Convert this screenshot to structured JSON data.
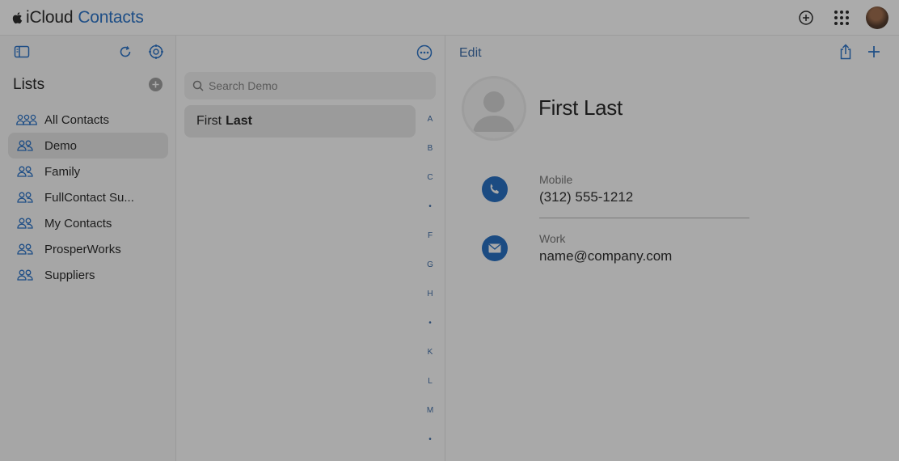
{
  "header": {
    "brand": "iCloud",
    "app_name": "Contacts",
    "icons": [
      "apple-logo-icon",
      "add-circle-icon",
      "app-grid-icon",
      "account-avatar"
    ]
  },
  "sidebar": {
    "icons": [
      "sidebar-toggle-icon",
      "refresh-icon",
      "settings-icon"
    ],
    "title": "Lists",
    "items": [
      {
        "label": "All Contacts",
        "icon": "all-contacts-group-icon",
        "selected": false
      },
      {
        "label": "Demo",
        "icon": "group-icon",
        "selected": true
      },
      {
        "label": "Family",
        "icon": "group-icon",
        "selected": false
      },
      {
        "label": "FullContact Su...",
        "icon": "group-icon",
        "selected": false
      },
      {
        "label": "My Contacts",
        "icon": "group-icon",
        "selected": false
      },
      {
        "label": "ProsperWorks",
        "icon": "group-icon",
        "selected": false
      },
      {
        "label": "Suppliers",
        "icon": "group-icon",
        "selected": false
      }
    ]
  },
  "contact_list": {
    "search_placeholder": "Search Demo",
    "contacts": [
      {
        "first": "First",
        "last": "Last"
      }
    ],
    "index_letters": [
      "A",
      "B",
      "C",
      "•",
      "F",
      "G",
      "H",
      "•",
      "K",
      "L",
      "M",
      "•"
    ]
  },
  "detail": {
    "edit_label": "Edit",
    "name": "First Last",
    "fields": [
      {
        "label": "Mobile",
        "value": "(312) 555-1212",
        "icon": "phone-icon"
      },
      {
        "label": "Work",
        "value": "name@company.com",
        "icon": "mail-icon"
      }
    ]
  },
  "colors": {
    "accent": "#1e4e86",
    "overlay_gray": "#a9a9a9"
  }
}
